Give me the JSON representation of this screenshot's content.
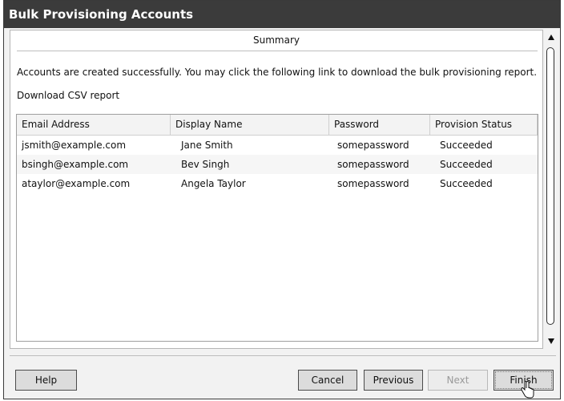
{
  "window": {
    "title": "Bulk Provisioning Accounts"
  },
  "summary": {
    "label": "Summary"
  },
  "message": "Accounts are created successfully. You may click the following link to download the bulk provisioning report.",
  "download_link": "Download CSV report",
  "table": {
    "columns": [
      "Email Address",
      "Display Name",
      "Password",
      "Provision Status"
    ],
    "rows": [
      [
        "jsmith@example.com",
        "Jane Smith",
        "somepassword",
        "Succeeded"
      ],
      [
        "bsingh@example.com",
        "Bev Singh",
        "somepassword",
        "Succeeded"
      ],
      [
        "ataylor@example.com",
        "Angela Taylor",
        "somepassword",
        "Succeeded"
      ]
    ]
  },
  "buttons": {
    "help": "Help",
    "cancel": "Cancel",
    "previous": "Previous",
    "next": "Next",
    "finish": "Finish"
  },
  "icons": {
    "scroll_up": "triangle-up-icon",
    "scroll_down": "triangle-down-icon",
    "cursor": "hand-pointer-icon"
  }
}
